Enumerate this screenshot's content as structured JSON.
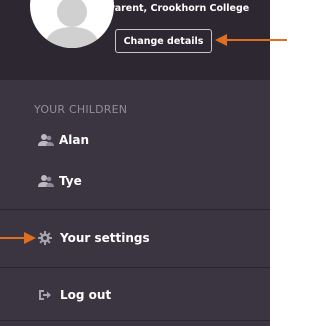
{
  "header": {
    "role_text": "Parent, Crookhorn College",
    "change_details_label": "Change details"
  },
  "children_section": {
    "heading": "YOUR CHILDREN",
    "items": [
      {
        "label": "Alan",
        "icon": "users-icon"
      },
      {
        "label": "Tye",
        "icon": "users-icon"
      }
    ]
  },
  "menu": {
    "settings_label": "Your settings",
    "logout_label": "Log out"
  },
  "colors": {
    "panel": "#3a3541",
    "header": "#2c2731",
    "muted_text": "#928d98",
    "annotation_arrow": "#e07020"
  }
}
